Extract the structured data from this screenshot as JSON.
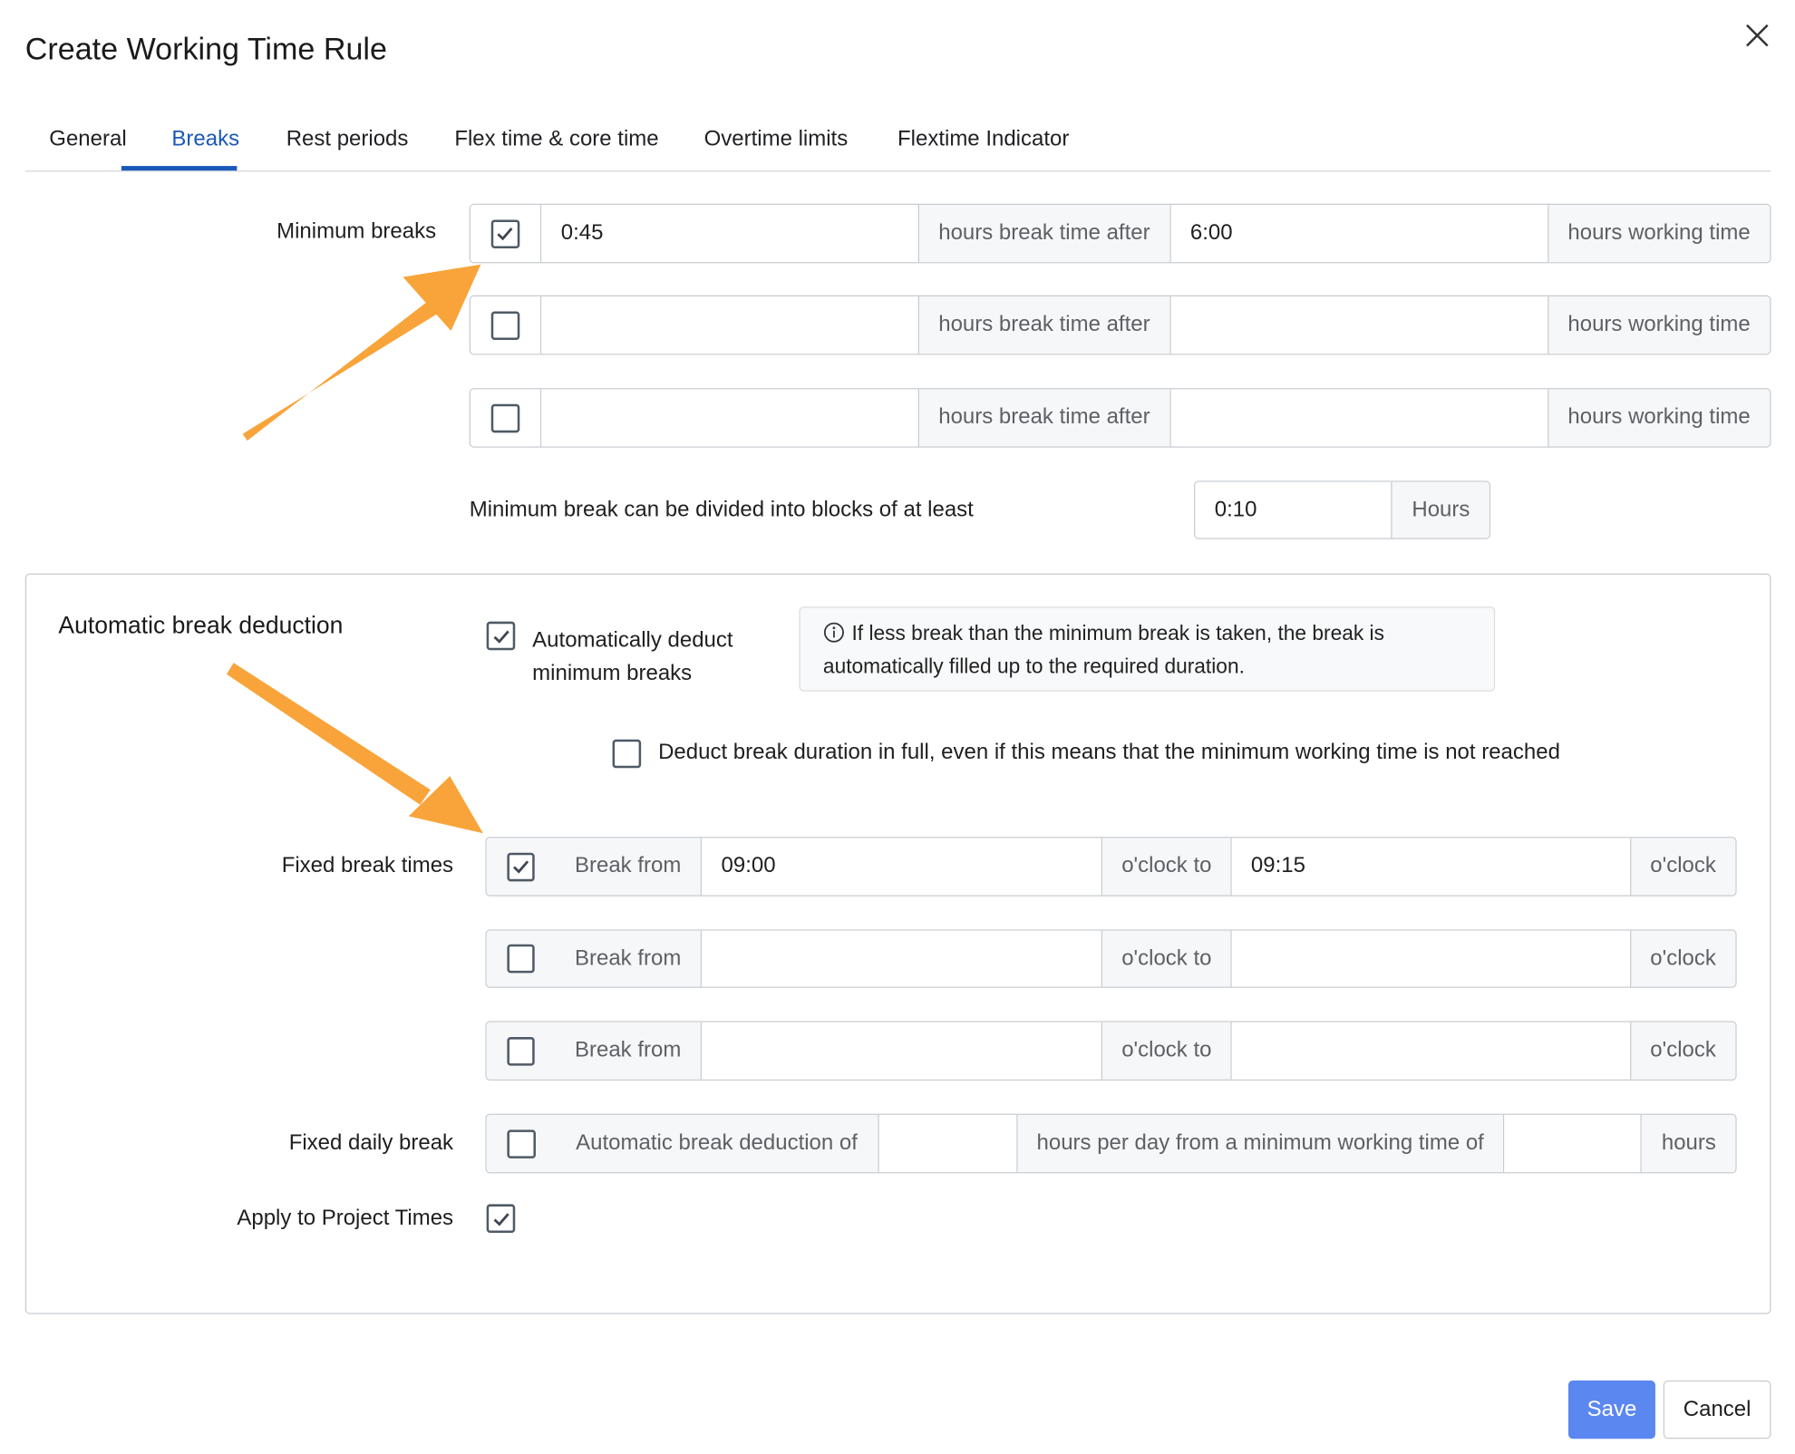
{
  "dialog": {
    "title": "Create Working Time Rule"
  },
  "tabs": [
    {
      "label": "General"
    },
    {
      "label": "Breaks",
      "active": true
    },
    {
      "label": "Rest periods"
    },
    {
      "label": "Flex time & core time"
    },
    {
      "label": "Overtime limits"
    },
    {
      "label": "Flextime Indicator"
    }
  ],
  "minimum_breaks": {
    "label": "Minimum breaks",
    "rows": [
      {
        "checked": true,
        "break_time": "0:45",
        "middle_label": "hours break time after",
        "working_time": "6:00",
        "end_label": "hours working time"
      },
      {
        "checked": false,
        "break_time": "",
        "middle_label": "hours break time after",
        "working_time": "",
        "end_label": "hours working time"
      },
      {
        "checked": false,
        "break_time": "",
        "middle_label": "hours break time after",
        "working_time": "",
        "end_label": "hours working time"
      }
    ],
    "divide_label": "Minimum break can be divided into blocks of at least",
    "divide_value": "0:10",
    "divide_unit": "Hours"
  },
  "automatic": {
    "title": "Automatic break deduction",
    "auto_deduct": {
      "checked": true,
      "line1": "Automatically deduct",
      "line2": "minimum breaks"
    },
    "info": {
      "line1": "If less break than the minimum break is taken, the break is",
      "line2": "automatically filled up to the required duration."
    },
    "full_deduct": {
      "checked": false,
      "label": "Deduct break duration in full, even if this means that the minimum working time is not reached"
    },
    "fixed_break_times": {
      "label": "Fixed break times",
      "rows": [
        {
          "checked": true,
          "from_label": "Break from",
          "from": "09:00",
          "to_label": "o'clock to",
          "to": "09:15",
          "end_label": "o'clock"
        },
        {
          "checked": false,
          "from_label": "Break from",
          "from": "",
          "to_label": "o'clock to",
          "to": "",
          "end_label": "o'clock"
        },
        {
          "checked": false,
          "from_label": "Break from",
          "from": "",
          "to_label": "o'clock to",
          "to": "",
          "end_label": "o'clock"
        }
      ]
    },
    "fixed_daily_break": {
      "label": "Fixed daily break",
      "checked": false,
      "prefix": "Automatic break deduction of",
      "value1": "",
      "middle": "hours per day from a minimum working time of",
      "value2": "",
      "suffix": "hours"
    },
    "project_times": {
      "label": "Apply to Project Times",
      "checked": true
    }
  },
  "footer": {
    "save": "Save",
    "cancel": "Cancel"
  },
  "colors": {
    "accent": "#1b58b8",
    "save_button": "#5b87f0",
    "arrow": "#f9a43a"
  },
  "icons": [
    "close-icon",
    "check-icon",
    "info-icon",
    "arrow-annotation"
  ]
}
